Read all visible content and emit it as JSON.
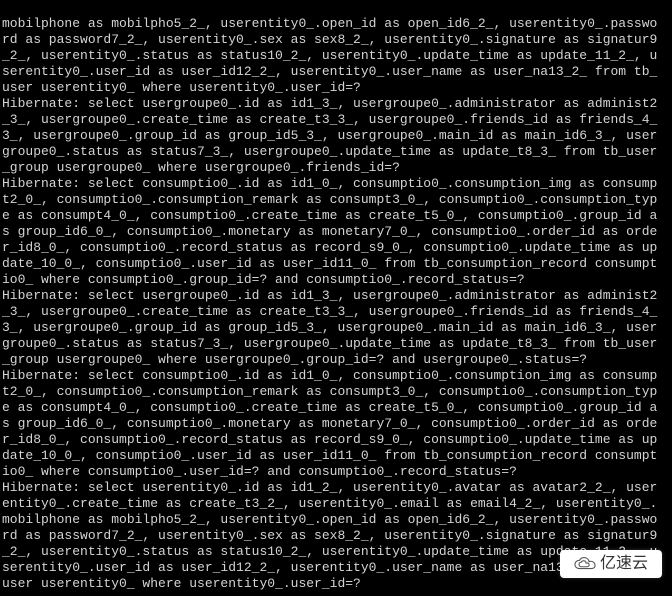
{
  "log": {
    "lines": [
      "mobilphone as mobilpho5_2_, userentity0_.open_id as open_id6_2_, userentity0_.passwo",
      "rd as password7_2_, userentity0_.sex as sex8_2_, userentity0_.signature as signatur9",
      "_2_, userentity0_.status as status10_2_, userentity0_.update_time as update_11_2_, u",
      "serentity0_.user_id as user_id12_2_, userentity0_.user_name as user_na13_2_ from tb_",
      "user userentity0_ where userentity0_.user_id=?",
      "Hibernate: select usergroupe0_.id as id1_3_, usergroupe0_.administrator as administ2",
      "_3_, usergroupe0_.create_time as create_t3_3_, usergroupe0_.friends_id as friends_4_",
      "3_, usergroupe0_.group_id as group_id5_3_, usergroupe0_.main_id as main_id6_3_, user",
      "groupe0_.status as status7_3_, usergroupe0_.update_time as update_t8_3_ from tb_user",
      "_group usergroupe0_ where usergroupe0_.friends_id=?",
      "Hibernate: select consumptio0_.id as id1_0_, consumptio0_.consumption_img as consump",
      "t2_0_, consumptio0_.consumption_remark as consumpt3_0_, consumptio0_.consumption_typ",
      "e as consumpt4_0_, consumptio0_.create_time as create_t5_0_, consumptio0_.group_id a",
      "s group_id6_0_, consumptio0_.monetary as monetary7_0_, consumptio0_.order_id as orde",
      "r_id8_0_, consumptio0_.record_status as record_s9_0_, consumptio0_.update_time as up",
      "date_10_0_, consumptio0_.user_id as user_id11_0_ from tb_consumption_record consumpt",
      "io0_ where consumptio0_.group_id=? and consumptio0_.record_status=?",
      "Hibernate: select usergroupe0_.id as id1_3_, usergroupe0_.administrator as administ2",
      "_3_, usergroupe0_.create_time as create_t3_3_, usergroupe0_.friends_id as friends_4_",
      "3_, usergroupe0_.group_id as group_id5_3_, usergroupe0_.main_id as main_id6_3_, user",
      "groupe0_.status as status7_3_, usergroupe0_.update_time as update_t8_3_ from tb_user",
      "_group usergroupe0_ where usergroupe0_.group_id=? and usergroupe0_.status=?",
      "Hibernate: select consumptio0_.id as id1_0_, consumptio0_.consumption_img as consump",
      "t2_0_, consumptio0_.consumption_remark as consumpt3_0_, consumptio0_.consumption_typ",
      "e as consumpt4_0_, consumptio0_.create_time as create_t5_0_, consumptio0_.group_id a",
      "s group_id6_0_, consumptio0_.monetary as monetary7_0_, consumptio0_.order_id as orde",
      "r_id8_0_, consumptio0_.record_status as record_s9_0_, consumptio0_.update_time as up",
      "date_10_0_, consumptio0_.user_id as user_id11_0_ from tb_consumption_record consumpt",
      "io0_ where consumptio0_.user_id=? and consumptio0_.record_status=?",
      "Hibernate: select userentity0_.id as id1_2_, userentity0_.avatar as avatar2_2_, user",
      "entity0_.create_time as create_t3_2_, userentity0_.email as email4_2_, userentity0_.",
      "mobilphone as mobilpho5_2_, userentity0_.open_id as open_id6_2_, userentity0_.passwo",
      "rd as password7_2_, userentity0_.sex as sex8_2_, userentity0_.signature as signatur9",
      "_2_, userentity0_.status as status10_2_, userentity0_.update_time as update_11_2_, u",
      "serentity0_.user_id as user_id12_2_, userentity0_.user_name as user_na13_2_ from tb_",
      "user userentity0_ where userentity0_.user_id=?"
    ]
  },
  "watermark": {
    "text": "亿速云"
  }
}
